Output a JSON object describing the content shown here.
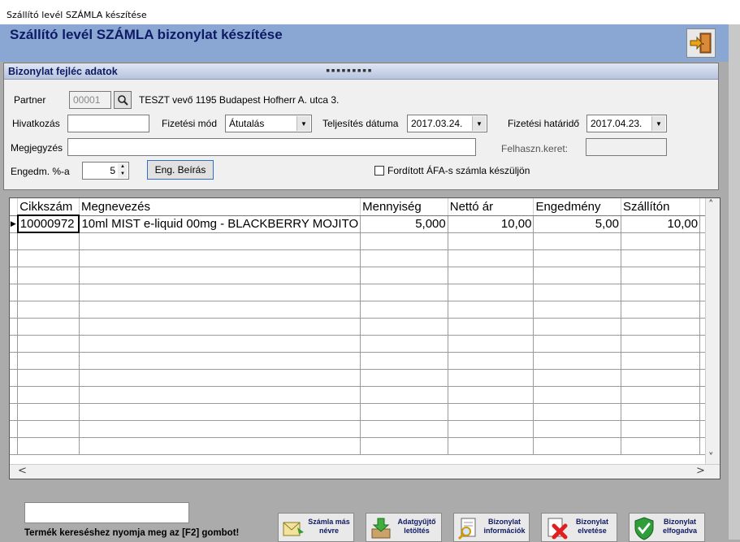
{
  "window": {
    "title": "Szállító levél SZÁMLA készítése"
  },
  "banner": {
    "title": "Szállító levél SZÁMLA bizonylat készítése"
  },
  "header": {
    "section_title": "Bizonylat fejléc adatok",
    "partner_label": "Partner",
    "partner_code": "00001",
    "partner_name": "TESZT vevő 1195 Budapest Hofherr A. utca 3.",
    "reference_label": "Hivatkozás",
    "reference_value": "",
    "payment_method_label": "Fizetési mód",
    "payment_method_value": "Átutalás",
    "completion_date_label": "Teljesítés dátuma",
    "completion_date_value": "2017.03.24.",
    "due_date_label": "Fizetési határidő",
    "due_date_value": "2017.04.23.",
    "note_label": "Megjegyzés",
    "note_value": "",
    "user_limit_label": "Felhaszn.keret:",
    "user_limit_value": "",
    "discount_label": "Engedm. %-a",
    "discount_value": "5",
    "discount_button": "Eng. Beírás",
    "reverse_vat_label": "Fordított ÁFA-s számla készüljön",
    "reverse_vat_checked": false
  },
  "grid": {
    "columns": [
      "Cikkszám",
      "Megnevezés",
      "Mennyiség",
      "Nettó ár",
      "Engedmény",
      "Szállítón"
    ],
    "rows": [
      [
        "10000972",
        "10ml MIST e-liquid 00mg - BLACKBERRY MOJITO",
        "5,000",
        "10,00",
        "5,00",
        "10,00"
      ]
    ]
  },
  "footer": {
    "search_value": "",
    "hint": "Termék kereséshez nyomja meg az [F2] gombot!",
    "buttons": [
      {
        "line1": "Számla más",
        "line2": "névre",
        "icon": "envelope-icon"
      },
      {
        "line1": "Adatgyűjtő",
        "line2": "letöltés",
        "icon": "download-icon"
      },
      {
        "line1": "Bizonylat",
        "line2": "információk",
        "icon": "document-search-icon"
      },
      {
        "line1": "Bizonylat",
        "line2": "elvetése",
        "icon": "reject-icon"
      },
      {
        "line1": "Bizonylat",
        "line2": "elfogadva",
        "icon": "accept-icon"
      }
    ]
  },
  "colors": {
    "banner": "#8aa7d4",
    "title_text": "#0e1a63",
    "background": "#ababab"
  }
}
